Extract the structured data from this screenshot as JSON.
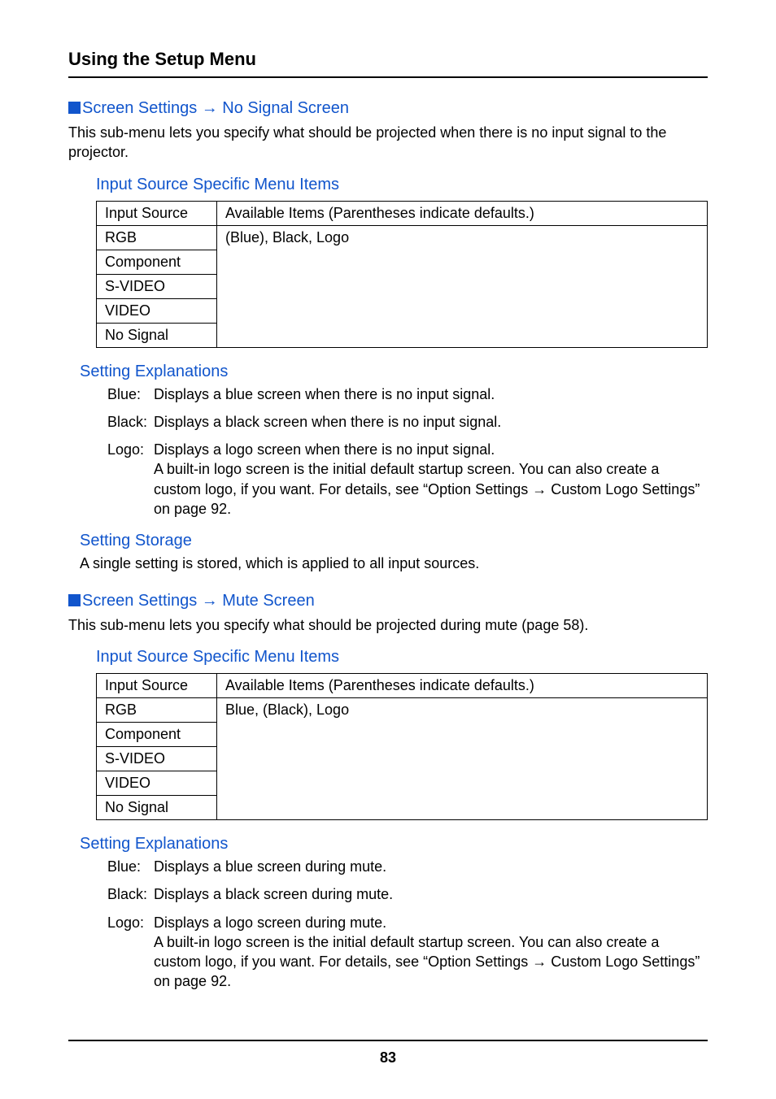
{
  "header": {
    "title": "Using the Setup Menu"
  },
  "section1": {
    "title": "Screen Settings → No Signal Screen",
    "intro": "This sub-menu lets you specify what should be projected when there is no input signal to the projector.",
    "menu_items_title": "Input Source Specific Menu Items",
    "table": {
      "header": {
        "col1": "Input Source",
        "col2": "Available Items (Parentheses indicate defaults.)"
      },
      "col2_value": "(Blue), Black, Logo",
      "rows": [
        "RGB",
        "Component",
        "S-VIDEO",
        "VIDEO",
        "No Signal"
      ]
    },
    "explanations_title": "Setting Explanations",
    "explanations": [
      {
        "label": "Blue:",
        "text": "Displays a blue screen when there is no input signal."
      },
      {
        "label": "Black:",
        "text": "Displays a black screen when there is no input signal."
      },
      {
        "label": "Logo:",
        "text": "Displays a logo screen when there is no input signal.\nA built-in logo screen is the initial default startup screen. You can also create a custom logo, if you want. For details, see “Option Settings → Custom Logo Settings” on page 92."
      }
    ],
    "storage_title": "Setting Storage",
    "storage_text": "A single setting is stored, which is applied to all input sources."
  },
  "section2": {
    "title": "Screen Settings → Mute Screen",
    "intro": "This sub-menu lets you specify what should be projected during mute (page 58).",
    "menu_items_title": "Input Source Specific Menu Items",
    "table": {
      "header": {
        "col1": "Input Source",
        "col2": "Available Items (Parentheses indicate defaults.)"
      },
      "col2_value": "Blue, (Black), Logo",
      "rows": [
        "RGB",
        "Component",
        "S-VIDEO",
        "VIDEO",
        "No Signal"
      ]
    },
    "explanations_title": "Setting Explanations",
    "explanations": [
      {
        "label": "Blue:",
        "text": "Displays a blue screen during mute."
      },
      {
        "label": "Black:",
        "text": "Displays a black screen during mute."
      },
      {
        "label": "Logo:",
        "text": "Displays a logo screen during mute.\nA built-in logo screen is the initial default startup screen. You can also create a custom logo, if you want. For details, see “Option Settings → Custom Logo Settings” on page 92."
      }
    ]
  },
  "footer": {
    "page_number": "83"
  }
}
